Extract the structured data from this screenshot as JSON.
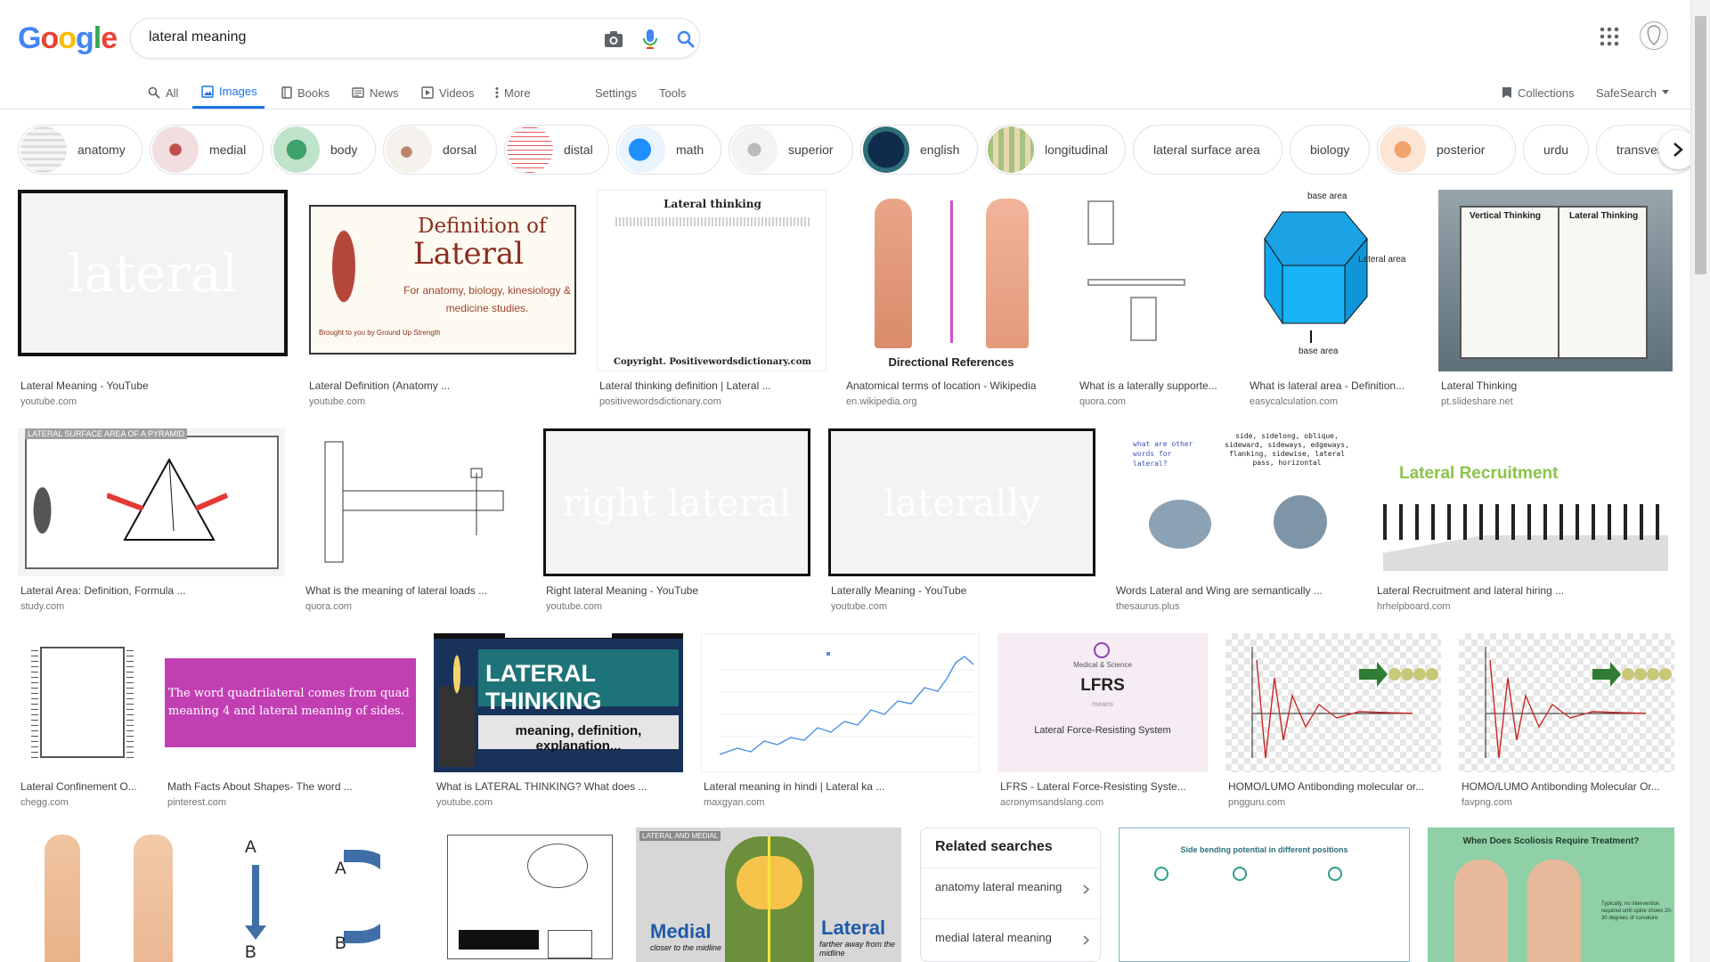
{
  "logo": {
    "letters": [
      "G",
      "o",
      "o",
      "g",
      "l",
      "e"
    ],
    "colors": [
      "#4285F4",
      "#EA4335",
      "#FBBC05",
      "#4285F4",
      "#34A853",
      "#EA4335"
    ]
  },
  "search": {
    "query": "lateral meaning",
    "icons": [
      "camera-icon",
      "microphone-icon",
      "search-icon"
    ]
  },
  "tabs": {
    "all": "All",
    "images": "Images",
    "books": "Books",
    "news": "News",
    "videos": "Videos",
    "more": "More",
    "settings": "Settings",
    "tools": "Tools",
    "collections": "Collections",
    "safesearch": "SafeSearch"
  },
  "chips": [
    "anatomy",
    "medial",
    "body",
    "dorsal",
    "distal",
    "math",
    "superior",
    "english",
    "longitudinal",
    "lateral surface area",
    "biology",
    "posterior",
    "urdu",
    "transverse"
  ],
  "results": [
    {
      "title": "Lateral Meaning - YouTube",
      "source": "youtube.com",
      "img_text": "lateral"
    },
    {
      "title": "Lateral Definition (Anatomy ...",
      "source": "youtube.com",
      "img_text": "Definition of",
      "img_text2": "Lateral",
      "img_text3": "For anatomy, biology, kinesiology & medicine studies.",
      "img_text4": "Brought to you by Ground Up Strength"
    },
    {
      "title": "Lateral thinking definition | Lateral ...",
      "source": "positivewordsdictionary.com",
      "img_text": "Lateral thinking",
      "img_text2": "Copyright.  Positivewordsdictionary.com"
    },
    {
      "title": "Anatomical terms of location - Wikipedia",
      "source": "en.wikipedia.org",
      "img_text": "Directional References"
    },
    {
      "title": "What is a laterally supporte...",
      "source": "quora.com"
    },
    {
      "title": "What is lateral area - Definition...",
      "source": "easycalculation.com",
      "img_text": "base area",
      "img_text2": "Lateral area",
      "img_text3": "base area"
    },
    {
      "title": "Lateral Thinking",
      "source": "pt.slideshare.net",
      "img_text": "Vertical Thinking",
      "img_text2": "Lateral Thinking"
    },
    {
      "title": "Lateral Area: Definition, Formula ...",
      "source": "study.com",
      "img_text": "LATERAL SURFACE AREA OF A PYRAMID"
    },
    {
      "title": "What is the meaning of lateral loads ...",
      "source": "quora.com"
    },
    {
      "title": "Right lateral Meaning - YouTube",
      "source": "youtube.com",
      "img_text": "right lateral"
    },
    {
      "title": "Laterally Meaning - YouTube",
      "source": "youtube.com",
      "img_text": "laterally"
    },
    {
      "title": "Words Lateral and Wing are semantically ...",
      "source": "thesaurus.plus",
      "img_text": "what are other words for lateral?",
      "img_text2": "side, sidelong, oblique, sideward, sideways, edgeways, flanking, sidewise, lateral pass, horizontal"
    },
    {
      "title": "Lateral Recruitment and lateral hiring ...",
      "source": "hrhelpboard.com",
      "img_text": "Lateral Recruitment"
    },
    {
      "title": "Lateral Confinement O...",
      "source": "chegg.com"
    },
    {
      "title": "Math Facts About Shapes- The word ...",
      "source": "pinterest.com",
      "img_text": "The word quadrilateral comes from quad meaning 4 and lateral meaning of sides."
    },
    {
      "title": "What is LATERAL THINKING? What does ...",
      "source": "youtube.com",
      "img_text": "LATERAL THINKING",
      "img_text2": "meaning, definition, explanation..."
    },
    {
      "title": "Lateral meaning in hindi | Lateral ka ...",
      "source": "maxgyan.com"
    },
    {
      "title": "LFRS - Lateral Force-Resisting Syste...",
      "source": "acronymsandslang.com",
      "img_text": "Medical & Science",
      "img_text2": "LFRS",
      "img_text3": "means",
      "img_text4": "Lateral Force-Resisting System"
    },
    {
      "title": "HOMO/LUMO Antibonding molecular or...",
      "source": "pngguru.com"
    },
    {
      "title": "HOMO/LUMO Antibonding Molecular Or...",
      "source": "favpng.com"
    }
  ],
  "row4": {
    "arrows": {
      "a1": "A",
      "b1": "B",
      "a2": "A",
      "b2": "B"
    },
    "medial": {
      "caption": "LATERAL AND MEDIAL",
      "medial": "Medial",
      "medial_sub": "closer to the midline",
      "lateral": "Lateral",
      "lateral_sub": "farther away from the midline"
    },
    "side_bending": {
      "title": "Side bending potential in different positions"
    },
    "scoliosis": {
      "title": "When Does Scoliosis Require Treatment?",
      "note": "Typically, no intervention required until spine shows 20-30 degrees of curvature"
    }
  },
  "related": {
    "title": "Related searches",
    "items": [
      "anatomy lateral meaning",
      "medial lateral meaning"
    ]
  }
}
